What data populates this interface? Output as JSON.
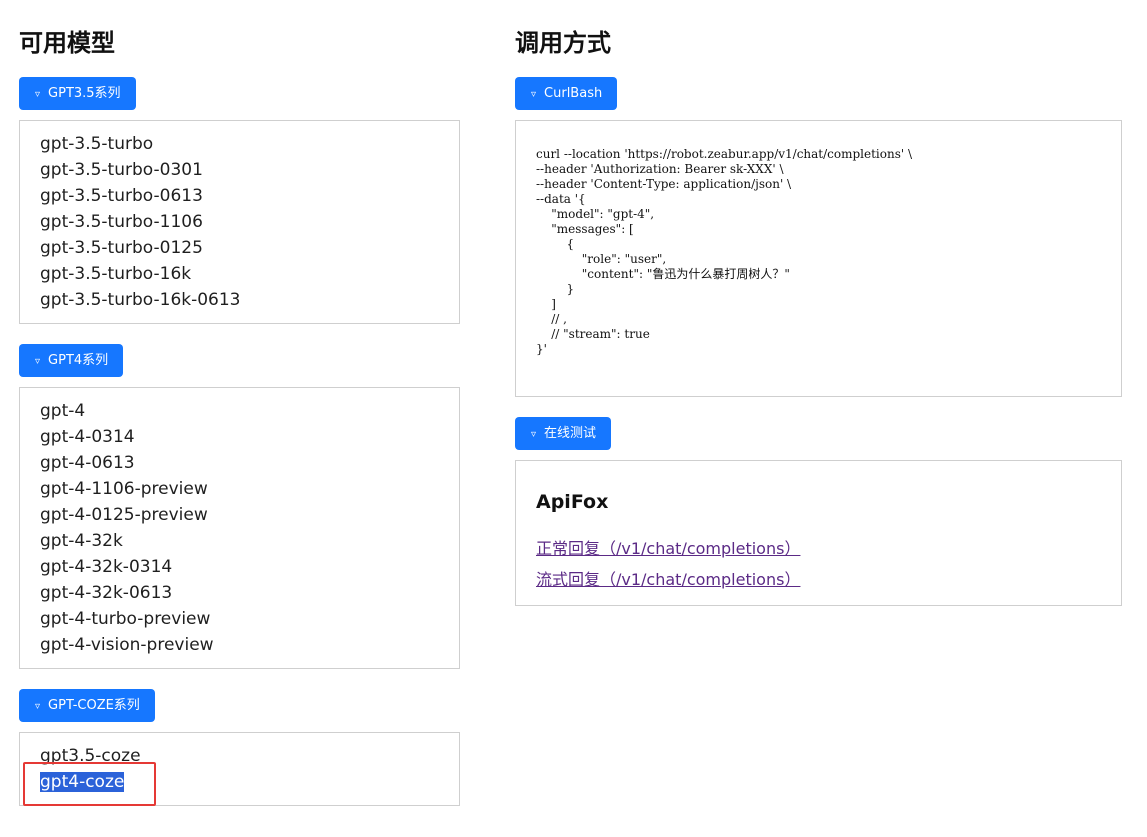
{
  "left": {
    "title": "可用模型",
    "groups": [
      {
        "toggle_label": "GPT3.5系列",
        "models": [
          "gpt-3.5-turbo",
          "gpt-3.5-turbo-0301",
          "gpt-3.5-turbo-0613",
          "gpt-3.5-turbo-1106",
          "gpt-3.5-turbo-0125",
          "gpt-3.5-turbo-16k",
          "gpt-3.5-turbo-16k-0613"
        ]
      },
      {
        "toggle_label": "GPT4系列",
        "models": [
          "gpt-4",
          "gpt-4-0314",
          "gpt-4-0613",
          "gpt-4-1106-preview",
          "gpt-4-0125-preview",
          "gpt-4-32k",
          "gpt-4-32k-0314",
          "gpt-4-32k-0613",
          "gpt-4-turbo-preview",
          "gpt-4-vision-preview"
        ]
      },
      {
        "toggle_label": "GPT-COZE系列",
        "models": [
          "gpt3.5-coze",
          "gpt4-coze"
        ],
        "selected_model": "gpt4-coze"
      }
    ]
  },
  "right": {
    "title": "调用方式",
    "curl": {
      "toggle_label": "CurlBash",
      "code": "curl --location 'https://robot.zeabur.app/v1/chat/completions' \\\n--header 'Authorization: Bearer sk-XXX' \\\n--header 'Content-Type: application/json' \\\n--data '{\n    \"model\": \"gpt-4\",\n    \"messages\": [\n        {\n            \"role\": \"user\",\n            \"content\": \"鲁迅为什么暴打周树人？\"\n        }\n    ]\n    // ,\n    // \"stream\": true\n}'"
    },
    "online": {
      "toggle_label": "在线测试",
      "heading": "ApiFox",
      "links": [
        "正常回复（/v1/chat/completions）",
        "流式回复（/v1/chat/completions）"
      ]
    }
  },
  "toggle_icon": "triangle-down-icon",
  "colors": {
    "accent": "#1677ff",
    "link": "#5b2a86",
    "selection": "#2b62d9",
    "annotation": "#e53935"
  }
}
